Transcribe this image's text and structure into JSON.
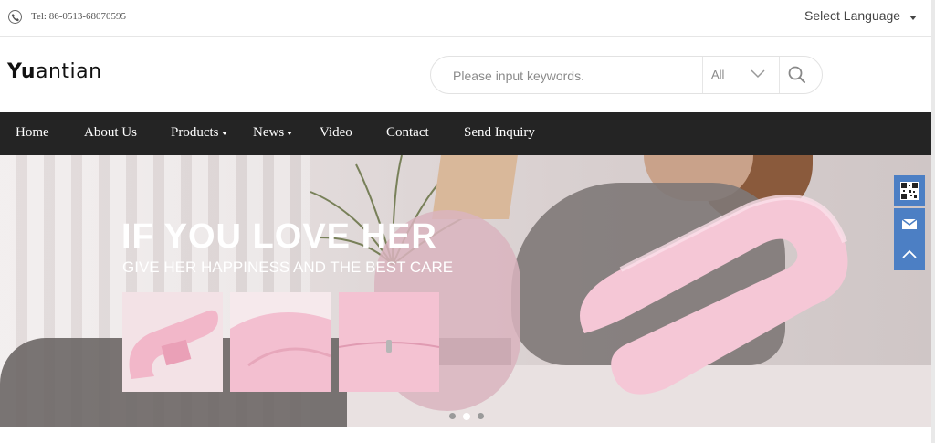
{
  "topbar": {
    "tel_label": "Tel:  86-0513-68070595",
    "language_label": "Select Language"
  },
  "header": {
    "logo_text_a": "Yu",
    "logo_text_b": "antian",
    "search": {
      "placeholder": "Please input keywords.",
      "category": "All"
    }
  },
  "nav": {
    "items": [
      {
        "label": "Home"
      },
      {
        "label": "About Us"
      },
      {
        "label": "Products"
      },
      {
        "label": "News"
      },
      {
        "label": "Video"
      },
      {
        "label": "Contact"
      },
      {
        "label": "Send Inquiry"
      }
    ]
  },
  "banner": {
    "headline": "IF YOU LOVE HER",
    "subhead": "GIVE HER HAPPINESS AND THE BEST CARE",
    "active_slide": 2,
    "slide_count": 3
  },
  "side_buttons": [
    "qr-code-icon",
    "mail-icon",
    "back-to-top-icon"
  ],
  "colors": {
    "nav_bg": "#242424",
    "side_btn": "#4c7fc4",
    "pillow_pink": "#f2c4d3"
  }
}
